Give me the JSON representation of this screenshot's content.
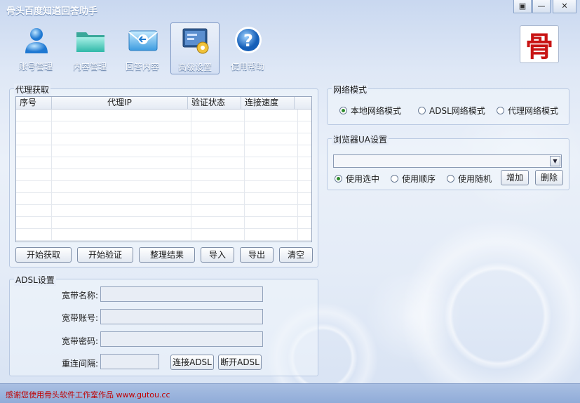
{
  "window": {
    "title": "骨头百度知道回答助手",
    "controls": [
      "restore-icon",
      "minimize-icon",
      "close-icon"
    ]
  },
  "toolbar": {
    "items": [
      {
        "label": "账号管理",
        "icon": "user-icon"
      },
      {
        "label": "内容管理",
        "icon": "folder-icon"
      },
      {
        "label": "回答内容",
        "icon": "mail-reply-icon"
      },
      {
        "label": "高级设置",
        "icon": "settings-monitor-icon",
        "active": true
      },
      {
        "label": "使用帮助",
        "icon": "help-icon"
      }
    ],
    "logo_char": "骨"
  },
  "proxy": {
    "title": "代理获取",
    "columns": [
      "序号",
      "代理IP",
      "验证状态",
      "连接速度"
    ],
    "rows": [],
    "buttons": [
      "开始获取",
      "开始验证",
      "整理结果",
      "导入",
      "导出",
      "清空"
    ]
  },
  "adsl": {
    "title": "ADSL设置",
    "fields": [
      {
        "label": "宽带名称:",
        "value": ""
      },
      {
        "label": "宽带账号:",
        "value": ""
      },
      {
        "label": "宽带密码:",
        "value": ""
      },
      {
        "label": "重连间隔:",
        "value": ""
      }
    ],
    "connect_label": "连接ADSL",
    "disconnect_label": "断开ADSL"
  },
  "network": {
    "title": "网络模式",
    "options": [
      "本地网络模式",
      "ADSL网络模式",
      "代理网络模式"
    ],
    "selected": 0
  },
  "ua": {
    "title": "浏览器UA设置",
    "selected_value": "",
    "options": [
      "使用选中",
      "使用顺序",
      "使用随机"
    ],
    "selected": 0,
    "add_label": "增加",
    "delete_label": "删除"
  },
  "status": {
    "text": "感谢您使用骨头软件工作室作品 www.gutou.cc"
  },
  "colors": {
    "accent": "#2d8a2d",
    "status_text": "#c00000",
    "logo": "#c81414"
  }
}
